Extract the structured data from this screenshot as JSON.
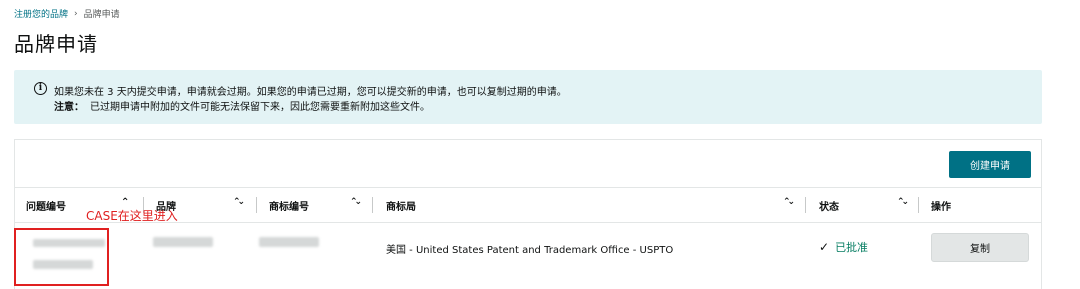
{
  "breadcrumb": {
    "parent": "注册您的品牌",
    "current": "品牌申请"
  },
  "page": {
    "title": "品牌申请"
  },
  "notice": {
    "line1": "如果您未在 3 天内提交申请，申请就会过期。如果您的申请已过期，您可以提交新的申请，也可以复制过期的申请。",
    "note_label": "注意：",
    "line2": "已过期申请中附加的文件可能无法保留下来，因此您需要重新附加这些文件。"
  },
  "toolbar": {
    "create_label": "创建申请"
  },
  "table": {
    "headers": {
      "case_id": "问题编号",
      "brand": "品牌",
      "trademark_no": "商标编号",
      "trademark_office": "商标局",
      "status": "状态",
      "actions": "操作"
    },
    "sort_glyph": "⌃",
    "sort_both_glyph": "⌃⌄",
    "rows": [
      {
        "trademark_office": "美国 - United States Patent and Trademark Office - USPTO",
        "status": "已批准",
        "action_label": "复制"
      }
    ]
  },
  "annotation": {
    "text": "CASE在这里进入",
    "color": "#e02020"
  },
  "colors": {
    "accent": "#007185",
    "approved": "#067d62",
    "notice_bg": "#e3f3f5"
  },
  "icons": {
    "info": "info-icon",
    "check": "check-icon"
  }
}
